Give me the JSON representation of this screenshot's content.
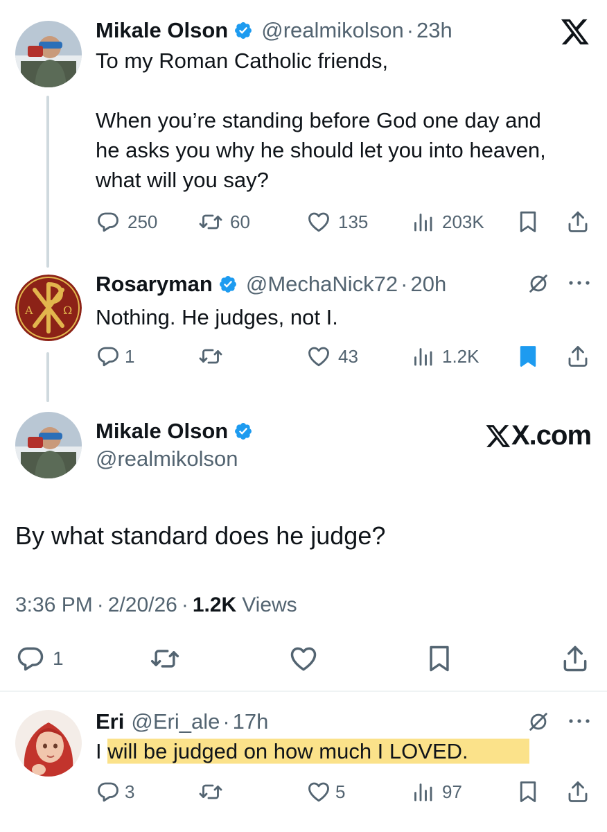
{
  "tweet1": {
    "name": "Mikale Olson",
    "handle": "@realmikolson",
    "sep": "·",
    "time": "23h",
    "line1": "To my Roman Catholic friends,",
    "line2": "When you’re standing before God one day and",
    "line3": "he asks you why he should let you into heaven,",
    "line4": "what will you say?",
    "replies": "250",
    "reposts": "60",
    "likes": "135",
    "views": "203K"
  },
  "tweet2": {
    "name": "Rosaryman",
    "handle": "@MechaNick72",
    "sep": "·",
    "time": "20h",
    "text": "Nothing. He judges, not I.",
    "replies": "1",
    "likes": "43",
    "views": "1.2K"
  },
  "main": {
    "name": "Mikale Olson",
    "handle": "@realmikolson",
    "brand": "X.com",
    "text": "By what standard does he judge?",
    "time": "3:36 PM",
    "sep": "·",
    "date": "2/20/26",
    "views_count": "1.2K",
    "views_label": "Views",
    "replies": "1"
  },
  "reply": {
    "name": "Eri",
    "handle": "@Eri_ale",
    "sep": "·",
    "time": "17h",
    "text_pre": "I ",
    "text_hl": "will be judged on how much I LOVED.",
    "replies": "3",
    "likes": "5",
    "views": "97"
  },
  "colors": {
    "verified": "#1d9bf0",
    "text": "#0f1419",
    "muted": "#536471",
    "highlight": "#fbe28a",
    "bookmark_active": "#1d9bf0"
  }
}
